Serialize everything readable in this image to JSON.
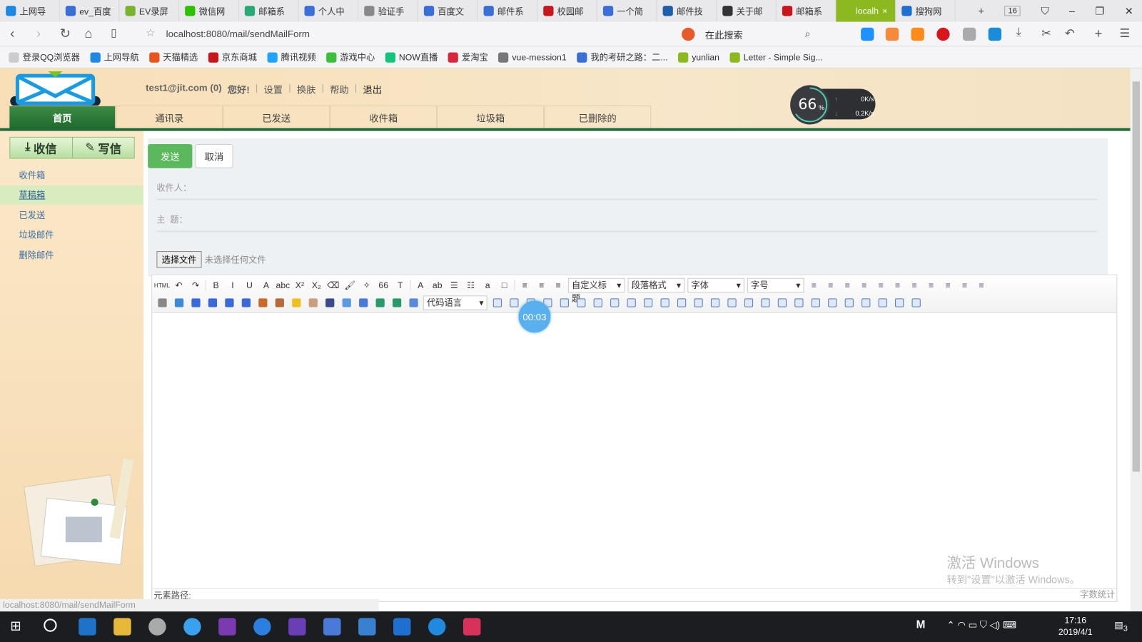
{
  "browser": {
    "tabs": [
      {
        "label": "上网导",
        "color": "#1e88e5"
      },
      {
        "label": "ev_百度",
        "color": "#3b6fd8"
      },
      {
        "label": "EV录屏",
        "color": "#7ab32e"
      },
      {
        "label": "微信网",
        "color": "#2dc100"
      },
      {
        "label": "邮箱系",
        "color": "#2aa876"
      },
      {
        "label": "个人中",
        "color": "#3b6fd8"
      },
      {
        "label": "验证手",
        "color": "#888888"
      },
      {
        "label": "百度文",
        "color": "#3b6fd8"
      },
      {
        "label": "邮件系",
        "color": "#3b6fd8"
      },
      {
        "label": "校园邮",
        "color": "#c8161d"
      },
      {
        "label": "一个简",
        "color": "#3b6fd8"
      },
      {
        "label": "邮件技",
        "color": "#1d5fa8"
      },
      {
        "label": "关于邮",
        "color": "#333333"
      },
      {
        "label": "邮箱系",
        "color": "#c8161d"
      },
      {
        "label": "localh",
        "color": "#8cb91f",
        "active": true
      },
      {
        "label": "搜狗网",
        "color": "#1e6fcf"
      }
    ],
    "tab_count": "16",
    "url": "localhost:8080/mail/sendMailForm",
    "search_placeholder": "在此搜索",
    "bookmarks": [
      {
        "label": "登录QQ浏览器",
        "color": "#cccccc"
      },
      {
        "label": "上网导航",
        "color": "#1e88e5"
      },
      {
        "label": "天猫精选",
        "color": "#e8541e"
      },
      {
        "label": "京东商城",
        "color": "#c8161d"
      },
      {
        "label": "腾讯视频",
        "color": "#1fa3ff"
      },
      {
        "label": "游戏中心",
        "color": "#3bbf3b"
      },
      {
        "label": "NOW直播",
        "color": "#13c47a"
      },
      {
        "label": "爱淘宝",
        "color": "#d8263c"
      },
      {
        "label": "vue-mession1",
        "color": "#777777"
      },
      {
        "label": "我的考研之路：二...",
        "color": "#3b6fd8"
      },
      {
        "label": "yunlian",
        "color": "#8cb91f"
      },
      {
        "label": "Letter - Simple Sig...",
        "color": "#8cb91f"
      }
    ]
  },
  "header": {
    "user": "test1@jit.com (0)",
    "greeting": "您好!",
    "links": [
      "设置",
      "换肤",
      "帮助",
      "退出"
    ],
    "nav_tabs": [
      "首页",
      "通讯录",
      "已发送",
      "收件箱",
      "垃圾箱",
      "已删除的"
    ],
    "speed": {
      "percent": "66",
      "unit": "%",
      "up": "0K/s",
      "down": "0.2K/s"
    }
  },
  "sidebar": {
    "quick": [
      "收信",
      "写信"
    ],
    "items": [
      "收件箱",
      "草稿箱",
      "已发送",
      "垃圾邮件",
      "删除邮件"
    ],
    "status_url": "localhost:8080/mail/sendMailForm"
  },
  "form": {
    "send": "发送",
    "cancel": "取消",
    "to_label": "收件人：",
    "subject_label": "主  题：",
    "file_button": "选择文件",
    "file_note": "未选择任何文件"
  },
  "editor": {
    "row1": [
      "html-icon",
      "undo-icon",
      "redo-icon",
      "|",
      "bold-icon",
      "italic-icon",
      "underline-icon",
      "border-a-icon",
      "strikethrough-icon",
      "superscript-icon",
      "subscript-icon",
      "eraser-icon",
      "format-brush-icon",
      "auto-format-icon",
      "quote-icon",
      "paste-text-icon",
      "|",
      "font-color-icon",
      "highlight-icon",
      "ordered-list-icon",
      "unordered-list-icon",
      "select-all-icon",
      "clear-doc-icon",
      "|",
      "row-spacing-top-icon",
      "row-spacing-bottom-icon",
      "line-height-icon"
    ],
    "row1_glyphs": [
      "HTML",
      "↶",
      "↷",
      "",
      "B",
      "I",
      "U",
      "A",
      "abc",
      "X²",
      "X₂",
      "⌫",
      "🖌",
      "✧",
      "66",
      "T",
      "",
      "A",
      "ab",
      "☰",
      "☷",
      "a",
      "□",
      "",
      "≡",
      "≡",
      "≡"
    ],
    "selects": [
      "自定义标题",
      "段落格式",
      "字体",
      "字号"
    ],
    "code_lang": "代码语言",
    "timer": "00:03",
    "path_label": "元素路径:",
    "word_count": "字数统计"
  },
  "watermark": {
    "title": "激活 Windows",
    "sub": "转到\"设置\"以激活 Windows。"
  },
  "taskbar": {
    "time": "17:16",
    "date": "2019/4/1",
    "notifications": "3"
  }
}
